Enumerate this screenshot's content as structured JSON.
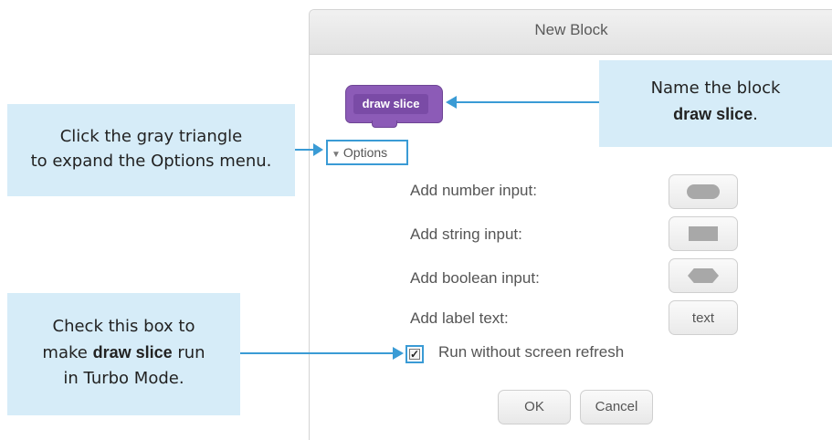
{
  "dialog": {
    "title": "New Block",
    "block_label": "draw slice",
    "options_label": "Options",
    "rows": [
      {
        "label": "Add number input:"
      },
      {
        "label": "Add string input:"
      },
      {
        "label": "Add boolean input:"
      },
      {
        "label": "Add label text:",
        "button_text": "text"
      }
    ],
    "checkbox_label": "Run without screen refresh",
    "ok_label": "OK",
    "cancel_label": "Cancel"
  },
  "callouts": {
    "name_line1": "Name the block",
    "name_bold": "draw slice",
    "name_tail": ".",
    "options_line1": "Click the gray triangle",
    "options_line2": "to expand the Options menu.",
    "check_line1": "Check this box to",
    "check_pre": "make",
    "check_bold": "draw slice",
    "check_post": "run",
    "check_line3": "in Turbo Mode."
  },
  "colors": {
    "callout_bg": "#d6ecf8",
    "accent": "#3a9bd5",
    "block_purple": "#8c5bb7"
  }
}
